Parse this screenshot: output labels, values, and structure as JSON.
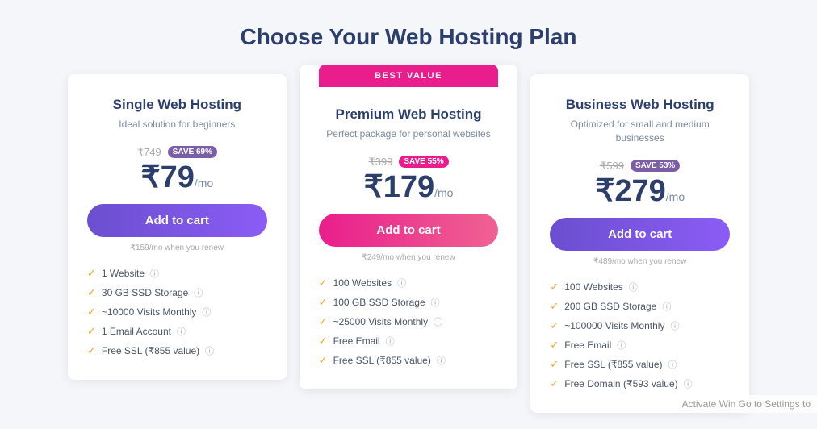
{
  "page": {
    "title": "Choose Your Web Hosting Plan"
  },
  "plans": [
    {
      "id": "single",
      "name": "Single Web Hosting",
      "description": "Ideal solution for beginners",
      "original_price": "₹749",
      "save_label": "SAVE 69%",
      "save_badge_class": "purple",
      "btn_class": "btn-purple",
      "price": "₹79",
      "per_mo": "/mo",
      "renew_note": "₹159/mo when you renew",
      "featured": false,
      "btn_label": "Add to cart",
      "features": [
        "1 Website",
        "30 GB SSD Storage",
        "~10000 Visits Monthly",
        "1 Email Account",
        "Free SSL (₹855 value)"
      ]
    },
    {
      "id": "premium",
      "name": "Premium Web Hosting",
      "description": "Perfect package for personal websites",
      "original_price": "₹399",
      "save_label": "SAVE 55%",
      "save_badge_class": "pink",
      "btn_class": "btn-pink",
      "price": "₹179",
      "per_mo": "/mo",
      "renew_note": "₹249/mo when you renew",
      "featured": true,
      "best_value_label": "BEST VALUE",
      "btn_label": "Add to cart",
      "features": [
        "100 Websites",
        "100 GB SSD Storage",
        "~25000 Visits Monthly",
        "Free Email",
        "Free SSL (₹855 value)"
      ]
    },
    {
      "id": "business",
      "name": "Business Web Hosting",
      "description": "Optimized for small and medium businesses",
      "original_price": "₹599",
      "save_label": "SAVE 53%",
      "save_badge_class": "violet",
      "btn_class": "btn-purple",
      "price": "₹279",
      "per_mo": "/mo",
      "renew_note": "₹489/mo when you renew",
      "featured": false,
      "btn_label": "Add to cart",
      "features": [
        "100 Websites",
        "200 GB SSD Storage",
        "~100000 Visits Monthly",
        "Free Email",
        "Free SSL (₹855 value)",
        "Free Domain (₹593 value)"
      ]
    }
  ],
  "activate_windows": "Activate Win\nGo to Settings to"
}
